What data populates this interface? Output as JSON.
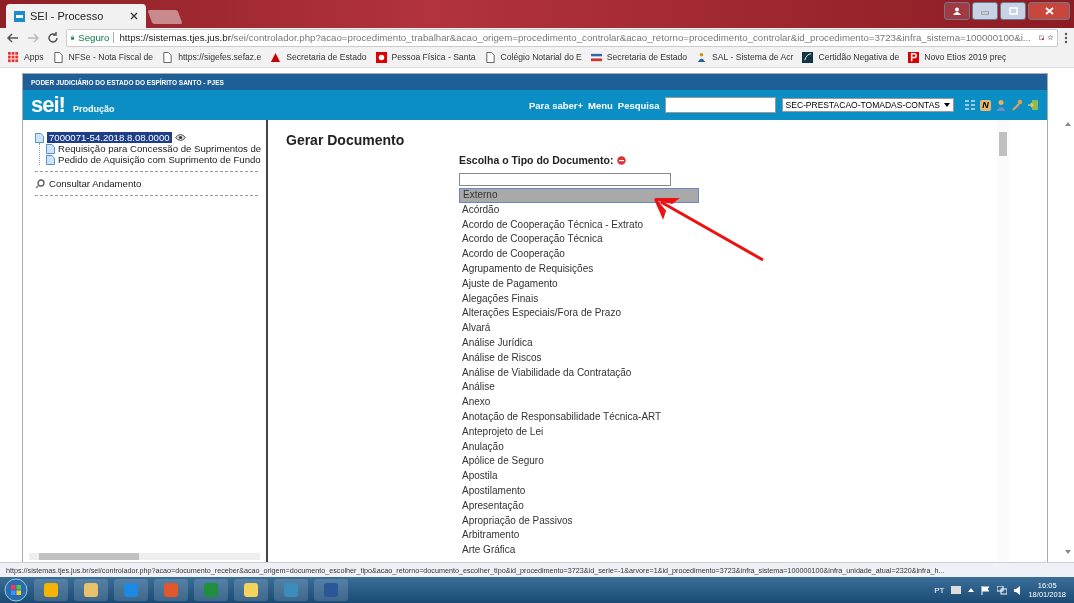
{
  "browser": {
    "tab": {
      "title": "SEI - Processo"
    },
    "address_bar": {
      "secure_label": "Seguro",
      "url_host": "https://sistemas.tjes.jus.br",
      "url_path": "/sei/controlador.php?acao=procedimento_trabalhar&acao_origem=procedimento_controlar&acao_retorno=procedimento_controlar&id_procedimento=3723&infra_sistema=100000100&i..."
    },
    "bookmarks": [
      {
        "kind": "apps",
        "label": "Apps"
      },
      {
        "kind": "page",
        "label": "NFSe - Nota Fiscal de"
      },
      {
        "kind": "page",
        "label": "https://sigefes.sefaz.e"
      },
      {
        "kind": "triangle",
        "label": "Secretaria de Estado"
      },
      {
        "kind": "red",
        "label": "Pessoa Física - Santa"
      },
      {
        "kind": "page",
        "label": "Colégio Notarial do E"
      },
      {
        "kind": "flag",
        "label": "Secretaria de Estado"
      },
      {
        "kind": "person",
        "label": "SAL - Sistema de Acr"
      },
      {
        "kind": "dark",
        "label": "Certidão Negativa de"
      },
      {
        "kind": "p",
        "label": "Novo Etios 2019 preç"
      }
    ]
  },
  "sei": {
    "org_title": "PODER JUDICIÁRIO DO ESTADO DO ESPÍRITO SANTO - PJES",
    "logo": "sei!",
    "environment": "Produção",
    "links": [
      "Para saber+",
      "Menu",
      "Pesquisa"
    ],
    "unit_select": "SEC-PRESTACAO-TOMADAS-CONTAS",
    "notes_badge": "N"
  },
  "tree": {
    "process": {
      "label": "7000071-54.2018.8.08.0000",
      "selected": true,
      "children": [
        {
          "label": "Requisição para Concessão de Suprimentos de"
        },
        {
          "label": "Pedido de Aquisição com Suprimento de Fundo"
        }
      ]
    },
    "actions": [
      "Consultar Andamento"
    ]
  },
  "content": {
    "title": "Gerar Documento",
    "prompt": "Escolha o Tipo do Documento:",
    "types": [
      {
        "label": "Externo",
        "selected": true
      },
      {
        "label": "Acórdão",
        "selected": false
      },
      {
        "label": "Acordo de Cooperação Técnica - Extrato",
        "selected": false
      },
      {
        "label": "Acordo de Cooperação Técnica",
        "selected": false
      },
      {
        "label": "Acordo de Cooperação",
        "selected": false
      },
      {
        "label": "Agrupamento de Requisições",
        "selected": false
      },
      {
        "label": "Ajuste de Pagamento",
        "selected": false
      },
      {
        "label": "Alegações Finais",
        "selected": false
      },
      {
        "label": "Alterações Especiais/Fora de Prazo",
        "selected": false
      },
      {
        "label": "Alvará",
        "selected": false
      },
      {
        "label": "Análise Jurídica",
        "selected": false
      },
      {
        "label": "Análise de Riscos",
        "selected": false
      },
      {
        "label": "Análise de Viabilidade da Contratação",
        "selected": false
      },
      {
        "label": "Análise",
        "selected": false
      },
      {
        "label": "Anexo",
        "selected": false
      },
      {
        "label": "Anotação de Responsabilidade Técnica-ART",
        "selected": false
      },
      {
        "label": "Anteprojeto de Lei",
        "selected": false
      },
      {
        "label": "Anulação",
        "selected": false
      },
      {
        "label": "Apólice de Seguro",
        "selected": false
      },
      {
        "label": "Apostila",
        "selected": false
      },
      {
        "label": "Apostilamento",
        "selected": false
      },
      {
        "label": "Apresentação",
        "selected": false
      },
      {
        "label": "Apropriação de Passivos",
        "selected": false
      },
      {
        "label": "Arbitramento",
        "selected": false
      },
      {
        "label": "Arte Gráfica",
        "selected": false
      }
    ]
  },
  "status_url": "https://sistemas.tjes.jus.br/sei/controlador.php?acao=documento_receber&acao_origem=documento_escolher_tipo&acao_retorno=documento_escolher_tipo&id_procedimento=3723&id_serie=-1&arvore=1&id_procedimento=3723&infra_sistema=100000100&infra_unidade_atual=2320&infra_h...",
  "taskbar": {
    "language": "PT",
    "time": "16:05",
    "date": "18/01/2018"
  }
}
